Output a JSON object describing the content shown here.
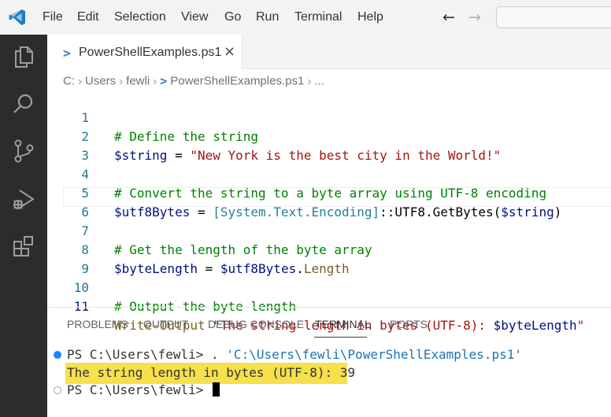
{
  "app": {
    "title_bar": {
      "menu": [
        "File",
        "Edit",
        "Selection",
        "View",
        "Go",
        "Run",
        "Terminal",
        "Help"
      ],
      "nav_back": "←",
      "nav_forward": "→"
    },
    "activity_bar": {
      "icons": [
        "files-icon",
        "search-icon",
        "source-control-icon",
        "run-debug-icon",
        "extensions-icon"
      ]
    },
    "tab": {
      "label": "PowerShellExamples.ps1",
      "close": "×",
      "ps_glyph": ">"
    },
    "breadcrumb": {
      "items": [
        "C:",
        "Users",
        "fewli",
        "PowerShellExamples.ps1",
        "..."
      ],
      "separator": "›"
    },
    "editor": {
      "lines": [
        {
          "num": "1",
          "comment": "# Define the string"
        },
        {
          "num": "2",
          "var": "$string",
          "op": " = ",
          "str": "\"New York is the best city in the World!\""
        },
        {
          "num": "3"
        },
        {
          "num": "4",
          "comment": "# Convert the string to a byte array using UTF-8 encoding"
        },
        {
          "num": "5",
          "var": "$utf8Bytes",
          "op": " = ",
          "type": "[System.Text.Encoding]",
          "rest1": "::UTF8.GetBytes(",
          "arg": "$string",
          "rest2": ")"
        },
        {
          "num": "6"
        },
        {
          "num": "7",
          "comment": "# Get the length of the byte array"
        },
        {
          "num": "8",
          "var": "$byteLength",
          "op": " = ",
          "var2": "$utf8Bytes",
          "dot": ".",
          "prop": "Length"
        },
        {
          "num": "9"
        },
        {
          "num": "10",
          "comment": "# Output the byte length"
        },
        {
          "num": "11",
          "fn": "Write-Output",
          "sp": " ",
          "str": "\"The string length in bytes (UTF-8): ",
          "strvar": "$byteLength",
          "strend": "\""
        }
      ]
    },
    "panel": {
      "tabs": [
        "PROBLEMS",
        "OUTPUT",
        "DEBUG CONSOLE",
        "TERMINAL",
        "PORTS"
      ],
      "active_tab": "TERMINAL"
    },
    "terminal": {
      "line1_prompt": "PS C:\\Users\\fewli> ",
      "line1_cmd": ". ",
      "line1_path": "'C:\\Users\\fewli\\PowerShellExamples.ps1'",
      "output": "The string length in bytes (UTF-8): 39",
      "line3_prompt": "PS C:\\Users\\fewli> "
    },
    "colors": {
      "accent": "#007acc",
      "highlight": "#f6e04b",
      "success_dot": "#1a85ff"
    }
  }
}
